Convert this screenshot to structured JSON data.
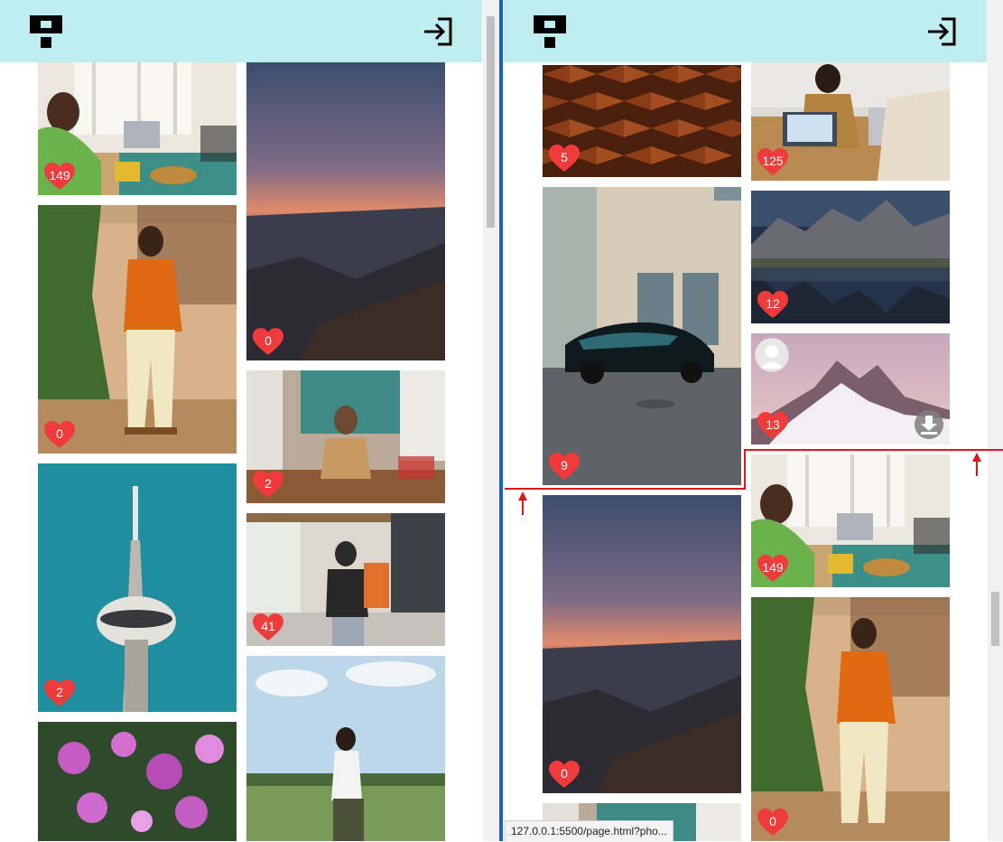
{
  "colors": {
    "header_bg": "#bfeef0",
    "like_heart": "#ef3b3b",
    "divider": "#1565c0",
    "marker": "#e01616"
  },
  "icons": {
    "logo": "unsplash-style-logo-icon",
    "login": "sign-in-icon",
    "like": "heart-icon",
    "avatar": "user-avatar-icon",
    "download": "download-icon"
  },
  "left_pane": {
    "photos": [
      {
        "subject": "woman at laptop",
        "likes": "149"
      },
      {
        "subject": "man in orange shirt",
        "likes": "0"
      },
      {
        "subject": "tower",
        "likes": "2"
      },
      {
        "subject": "pink flowers",
        "likes": ""
      },
      {
        "subject": "canyon sunset",
        "likes": "0"
      },
      {
        "subject": "woman at cafe",
        "likes": "2"
      },
      {
        "subject": "man with backpack",
        "likes": "41"
      },
      {
        "subject": "man in field",
        "likes": ""
      }
    ]
  },
  "right_pane": {
    "photos": [
      {
        "subject": "chocolate",
        "likes": "5"
      },
      {
        "subject": "black sports car",
        "likes": "9"
      },
      {
        "subject": "canyon sunset",
        "likes": "0"
      },
      {
        "subject": "people with laptops",
        "likes": "125"
      },
      {
        "subject": "mountain lake",
        "likes": "12"
      },
      {
        "subject": "snowy mountain",
        "likes": "13"
      },
      {
        "subject": "woman at laptop",
        "likes": "149"
      },
      {
        "subject": "man in orange shirt",
        "likes": "0"
      }
    ]
  },
  "status_url": "127.0.0.1:5500/page.html?pho..."
}
